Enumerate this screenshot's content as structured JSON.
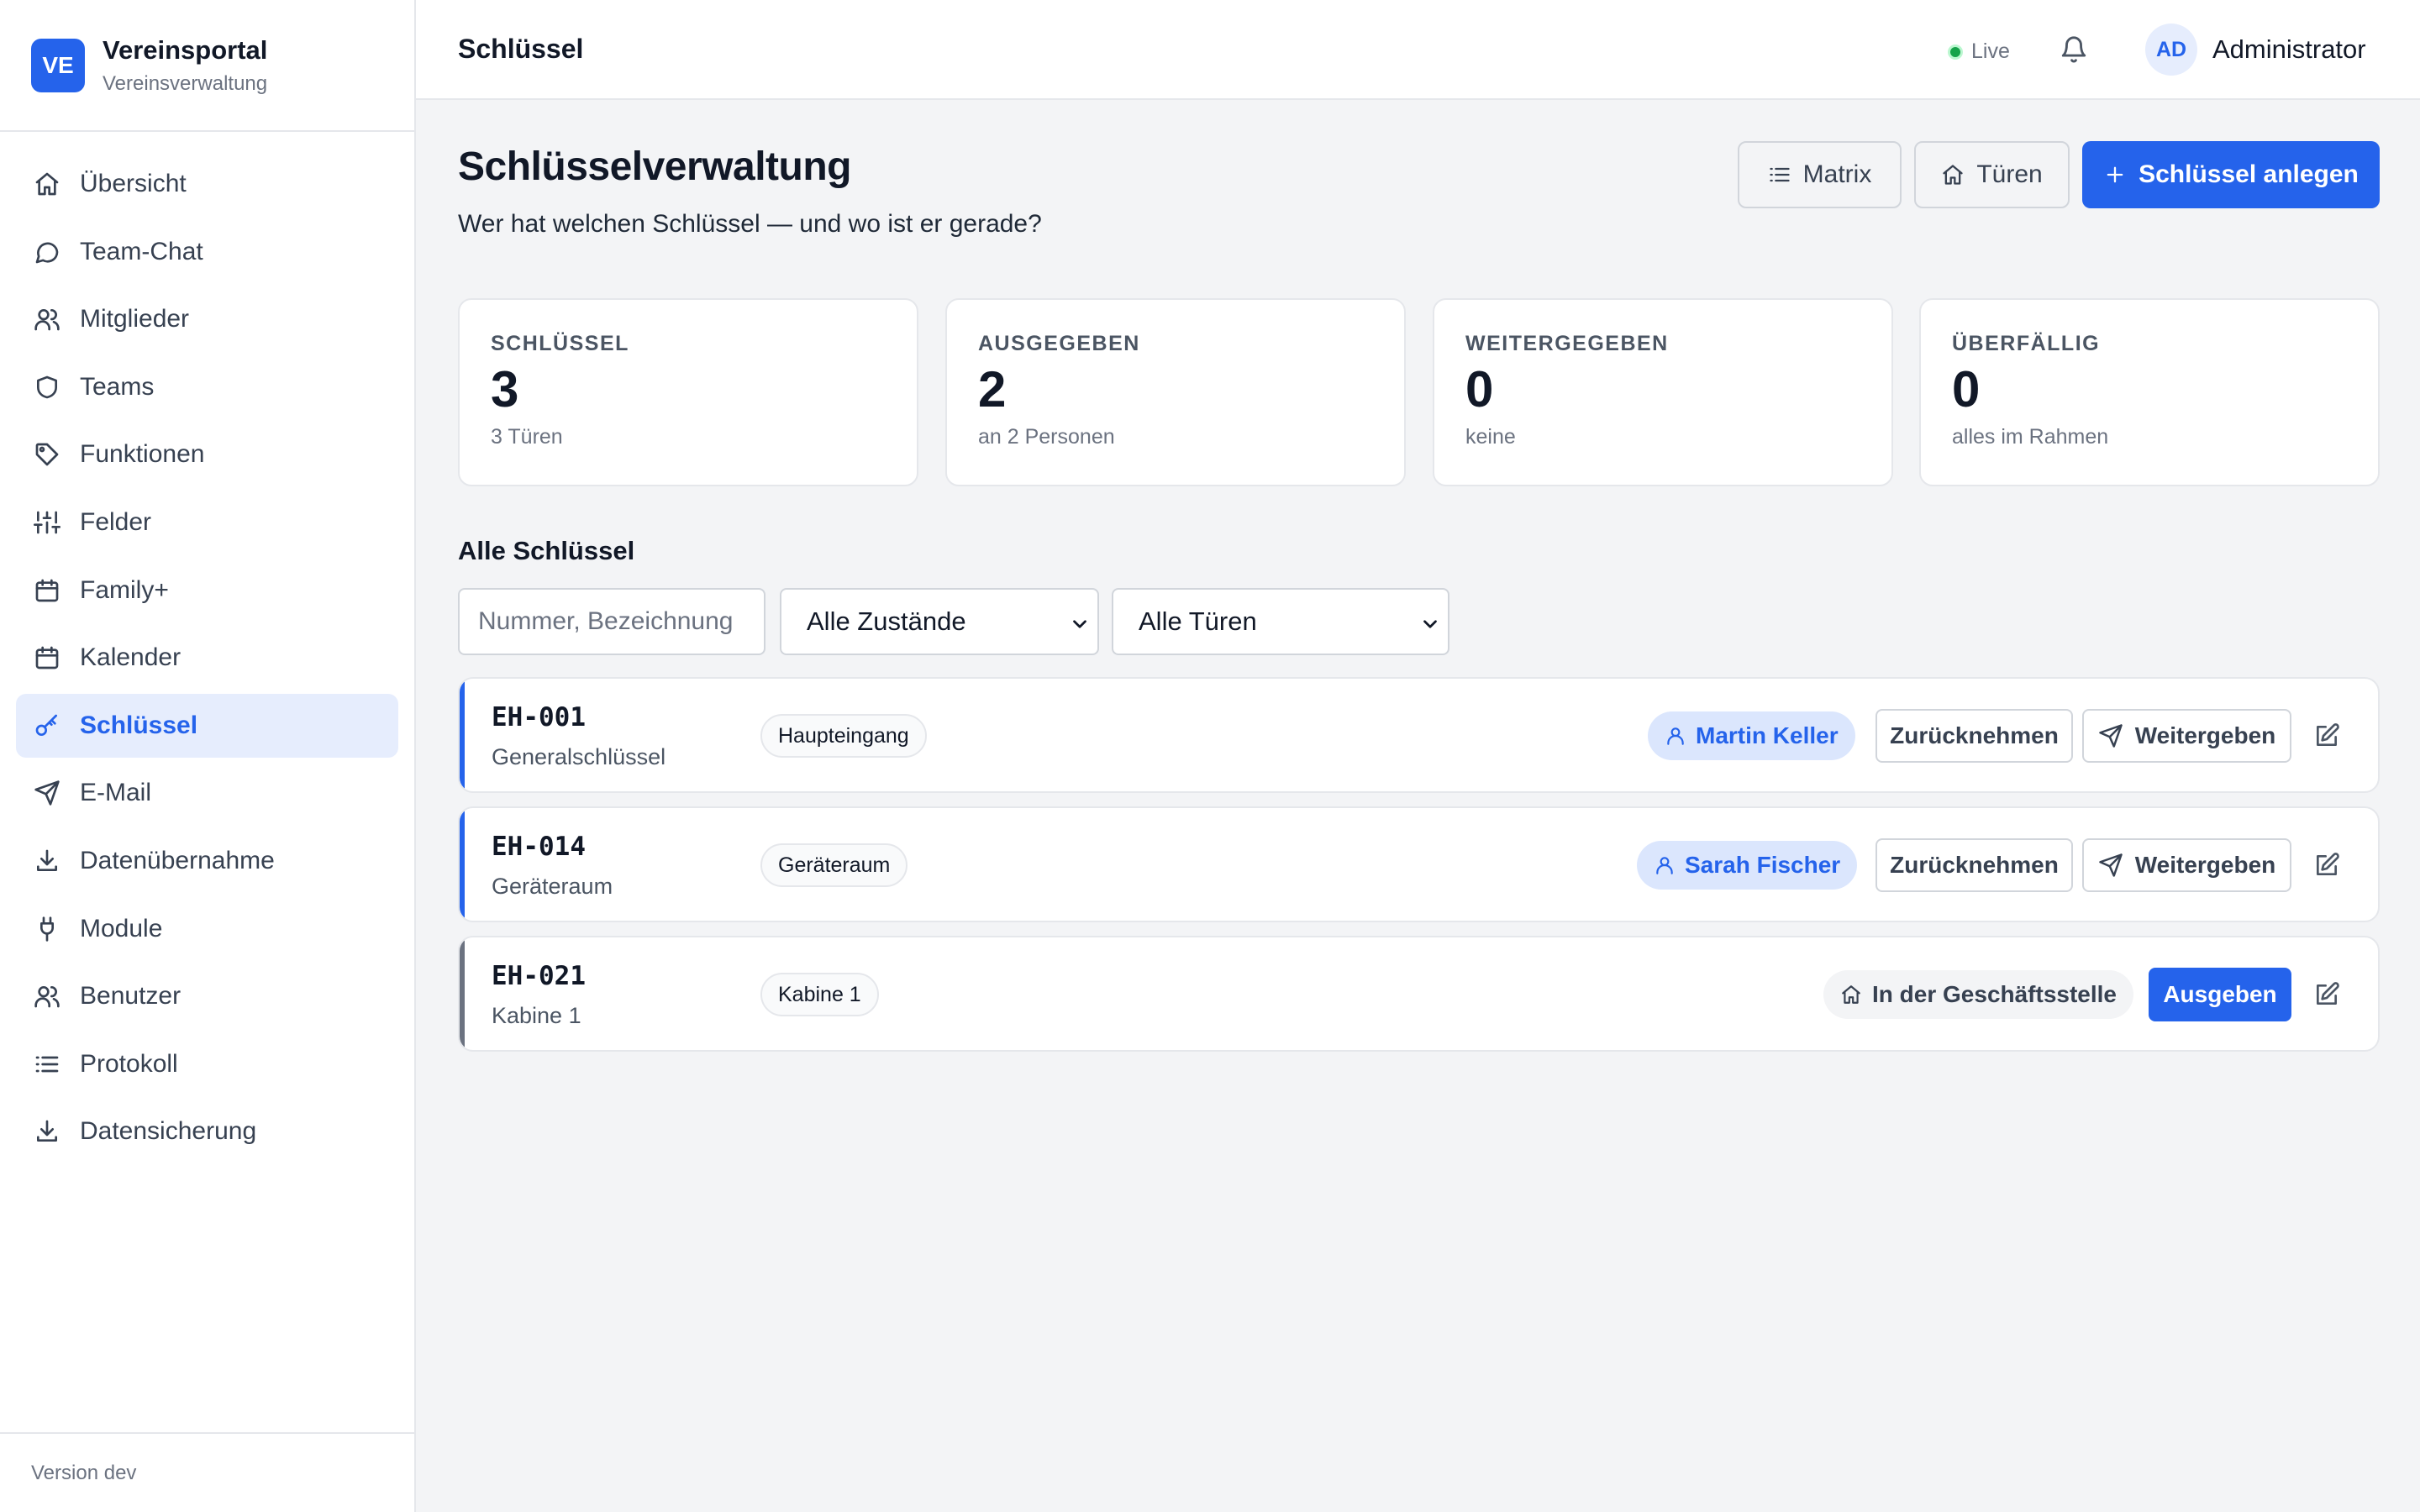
{
  "brand": {
    "logo": "VE",
    "title": "Vereinsportal",
    "subtitle": "Vereinsverwaltung"
  },
  "sidebar": {
    "items": [
      {
        "label": "Übersicht",
        "icon": "home-icon"
      },
      {
        "label": "Team-Chat",
        "icon": "chat-icon"
      },
      {
        "label": "Mitglieder",
        "icon": "users-icon"
      },
      {
        "label": "Teams",
        "icon": "shield-icon"
      },
      {
        "label": "Funktionen",
        "icon": "tag-icon"
      },
      {
        "label": "Felder",
        "icon": "sliders-icon"
      },
      {
        "label": "Family+",
        "icon": "calendar-icon"
      },
      {
        "label": "Kalender",
        "icon": "calendar-icon"
      },
      {
        "label": "Schlüssel",
        "icon": "key-icon",
        "active": true
      },
      {
        "label": "E-Mail",
        "icon": "send-icon"
      },
      {
        "label": "Datenübernahme",
        "icon": "download-icon"
      },
      {
        "label": "Module",
        "icon": "plug-icon"
      },
      {
        "label": "Benutzer",
        "icon": "users-icon"
      },
      {
        "label": "Protokoll",
        "icon": "list-icon"
      },
      {
        "label": "Datensicherung",
        "icon": "download-icon"
      }
    ],
    "version": "Version dev"
  },
  "topbar": {
    "title": "Schlüssel",
    "live_label": "Live",
    "user_initials": "AD",
    "user_name": "Administrator"
  },
  "page": {
    "title": "Schlüsselverwaltung",
    "subtitle": "Wer hat welchen Schlüssel — und wo ist er gerade?",
    "buttons": {
      "matrix": "Matrix",
      "doors": "Türen",
      "create": "Schlüssel anlegen"
    }
  },
  "stats": [
    {
      "label": "SCHLÜSSEL",
      "value": "3",
      "sub": "3 Türen"
    },
    {
      "label": "AUSGEGEBEN",
      "value": "2",
      "sub": "an 2 Personen"
    },
    {
      "label": "WEITERGEGEBEN",
      "value": "0",
      "sub": "keine"
    },
    {
      "label": "ÜBERFÄLLIG",
      "value": "0",
      "sub": "alles im Rahmen"
    }
  ],
  "list": {
    "title": "Alle Schlüssel",
    "search_placeholder": "Nummer, Bezeichnung",
    "filter_state": "Alle Zustände",
    "filter_doors": "Alle Türen",
    "actions": {
      "return": "Zurücknehmen",
      "pass_on": "Weitergeben",
      "issue": "Ausgeben"
    },
    "keys": [
      {
        "code": "EH-001",
        "name": "Generalschlüssel",
        "door": "Haupteingang",
        "holder": "Martin Keller",
        "status": "issued",
        "accent": "#2563eb"
      },
      {
        "code": "EH-014",
        "name": "Geräteraum",
        "door": "Geräteraum",
        "holder": "Sarah Fischer",
        "status": "issued",
        "accent": "#2563eb"
      },
      {
        "code": "EH-021",
        "name": "Kabine 1",
        "door": "Kabine 1",
        "location": "In der Geschäftsstelle",
        "status": "office",
        "accent": "#6b7280"
      }
    ]
  },
  "colors": {
    "accent": "#2563eb",
    "live": "#16a34a"
  }
}
